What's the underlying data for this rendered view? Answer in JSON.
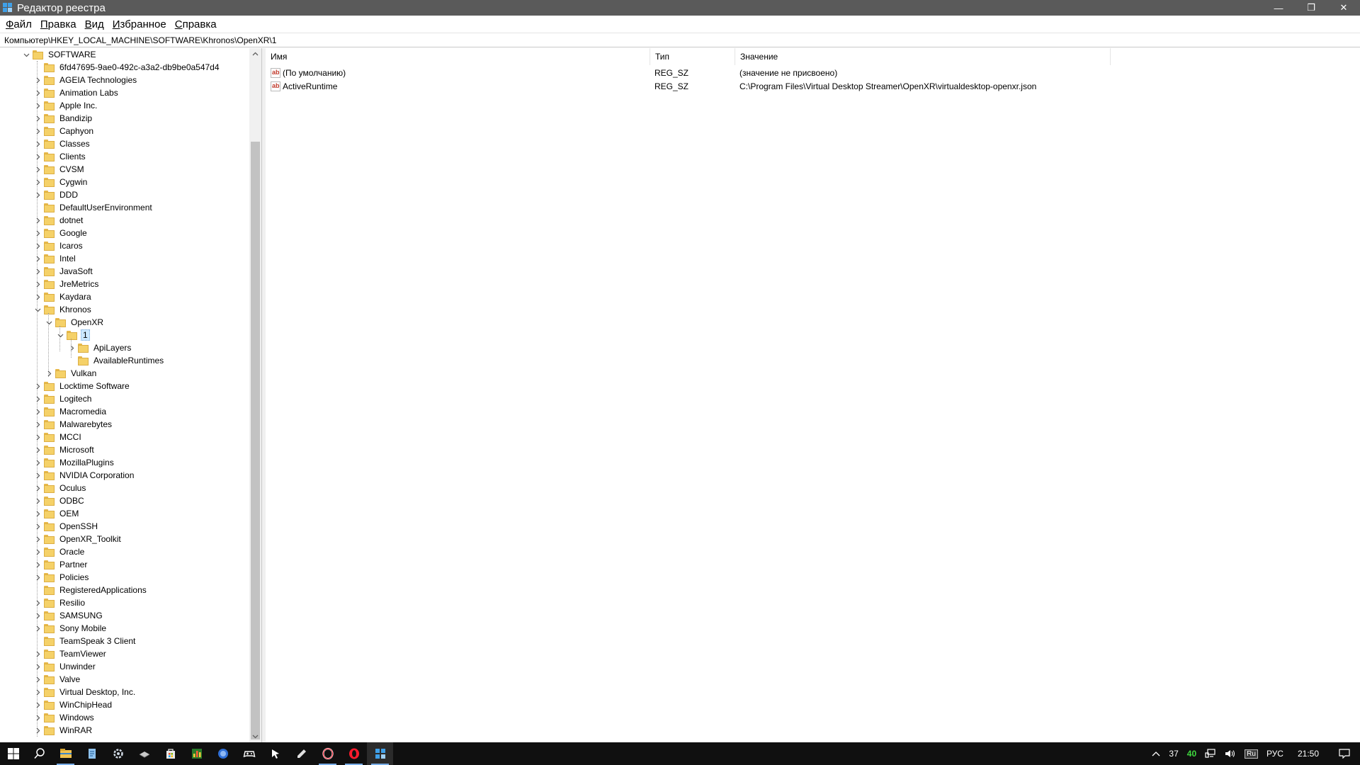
{
  "window": {
    "title": "Редактор реестра",
    "controls": {
      "minimize": "—",
      "maximize": "❐",
      "close": "✕"
    }
  },
  "menu": [
    {
      "label": "Файл",
      "key": "Ф",
      "rest": "айл"
    },
    {
      "label": "Правка",
      "key": "П",
      "rest": "равка"
    },
    {
      "label": "Вид",
      "key": "В",
      "rest": "ид"
    },
    {
      "label": "Избранное",
      "key": "И",
      "rest": "збранное"
    },
    {
      "label": "Справка",
      "key": "С",
      "rest": "правка"
    }
  ],
  "address": "Компьютер\\HKEY_LOCAL_MACHINE\\SOFTWARE\\Khronos\\OpenXR\\1",
  "tree": {
    "root": "SOFTWARE",
    "items": [
      {
        "label": "6fd47695-9ae0-492c-a3a2-db9be0a547d4",
        "level": 1,
        "state": "none"
      },
      {
        "label": "AGEIA Technologies",
        "level": 1,
        "state": "collapsed"
      },
      {
        "label": "Animation Labs",
        "level": 1,
        "state": "collapsed"
      },
      {
        "label": "Apple Inc.",
        "level": 1,
        "state": "collapsed"
      },
      {
        "label": "Bandizip",
        "level": 1,
        "state": "collapsed"
      },
      {
        "label": "Caphyon",
        "level": 1,
        "state": "collapsed"
      },
      {
        "label": "Classes",
        "level": 1,
        "state": "collapsed"
      },
      {
        "label": "Clients",
        "level": 1,
        "state": "collapsed"
      },
      {
        "label": "CVSM",
        "level": 1,
        "state": "collapsed"
      },
      {
        "label": "Cygwin",
        "level": 1,
        "state": "collapsed"
      },
      {
        "label": "DDD",
        "level": 1,
        "state": "collapsed"
      },
      {
        "label": "DefaultUserEnvironment",
        "level": 1,
        "state": "none"
      },
      {
        "label": "dotnet",
        "level": 1,
        "state": "collapsed"
      },
      {
        "label": "Google",
        "level": 1,
        "state": "collapsed"
      },
      {
        "label": "Icaros",
        "level": 1,
        "state": "collapsed"
      },
      {
        "label": "Intel",
        "level": 1,
        "state": "collapsed"
      },
      {
        "label": "JavaSoft",
        "level": 1,
        "state": "collapsed"
      },
      {
        "label": "JreMetrics",
        "level": 1,
        "state": "collapsed"
      },
      {
        "label": "Kaydara",
        "level": 1,
        "state": "collapsed"
      },
      {
        "label": "Khronos",
        "level": 1,
        "state": "expanded"
      },
      {
        "label": "OpenXR",
        "level": 2,
        "state": "expanded"
      },
      {
        "label": "1",
        "level": 3,
        "state": "expanded",
        "selected": true
      },
      {
        "label": "ApiLayers",
        "level": 4,
        "state": "collapsed"
      },
      {
        "label": "AvailableRuntimes",
        "level": 4,
        "state": "none"
      },
      {
        "label": "Vulkan",
        "level": 2,
        "state": "collapsed"
      },
      {
        "label": "Locktime Software",
        "level": 1,
        "state": "collapsed"
      },
      {
        "label": "Logitech",
        "level": 1,
        "state": "collapsed"
      },
      {
        "label": "Macromedia",
        "level": 1,
        "state": "collapsed"
      },
      {
        "label": "Malwarebytes",
        "level": 1,
        "state": "collapsed"
      },
      {
        "label": "MCCI",
        "level": 1,
        "state": "collapsed"
      },
      {
        "label": "Microsoft",
        "level": 1,
        "state": "collapsed"
      },
      {
        "label": "MozillaPlugins",
        "level": 1,
        "state": "collapsed"
      },
      {
        "label": "NVIDIA Corporation",
        "level": 1,
        "state": "collapsed"
      },
      {
        "label": "Oculus",
        "level": 1,
        "state": "collapsed"
      },
      {
        "label": "ODBC",
        "level": 1,
        "state": "collapsed"
      },
      {
        "label": "OEM",
        "level": 1,
        "state": "collapsed"
      },
      {
        "label": "OpenSSH",
        "level": 1,
        "state": "collapsed"
      },
      {
        "label": "OpenXR_Toolkit",
        "level": 1,
        "state": "collapsed"
      },
      {
        "label": "Oracle",
        "level": 1,
        "state": "collapsed"
      },
      {
        "label": "Partner",
        "level": 1,
        "state": "collapsed"
      },
      {
        "label": "Policies",
        "level": 1,
        "state": "collapsed"
      },
      {
        "label": "RegisteredApplications",
        "level": 1,
        "state": "none"
      },
      {
        "label": "Resilio",
        "level": 1,
        "state": "collapsed"
      },
      {
        "label": "SAMSUNG",
        "level": 1,
        "state": "collapsed"
      },
      {
        "label": "Sony Mobile",
        "level": 1,
        "state": "collapsed"
      },
      {
        "label": "TeamSpeak 3 Client",
        "level": 1,
        "state": "none"
      },
      {
        "label": "TeamViewer",
        "level": 1,
        "state": "collapsed"
      },
      {
        "label": "Unwinder",
        "level": 1,
        "state": "collapsed"
      },
      {
        "label": "Valve",
        "level": 1,
        "state": "collapsed"
      },
      {
        "label": "Virtual Desktop, Inc.",
        "level": 1,
        "state": "collapsed"
      },
      {
        "label": "WinChipHead",
        "level": 1,
        "state": "collapsed"
      },
      {
        "label": "Windows",
        "level": 1,
        "state": "collapsed"
      },
      {
        "label": "WinRAR",
        "level": 1,
        "state": "collapsed"
      }
    ]
  },
  "values": {
    "columns": [
      "Имя",
      "Тип",
      "Значение"
    ],
    "rows": [
      {
        "name": "(По умолчанию)",
        "type": "REG_SZ",
        "data": "(значение не присвоено)"
      },
      {
        "name": "ActiveRuntime",
        "type": "REG_SZ",
        "data": "C:\\Program Files\\Virtual Desktop Streamer\\OpenXR\\virtualdesktop-openxr.json"
      }
    ]
  },
  "taskbar": {
    "tray": {
      "temperature": "37",
      "gpu_temp": "40",
      "keyboard_badge": "Ru",
      "language": "РУС",
      "time": "21:50"
    }
  },
  "colors": {
    "titlebar": "#5a5a5a",
    "folder": "#f5d168",
    "selection": "#cce8ff",
    "taskbar": "#101010"
  }
}
